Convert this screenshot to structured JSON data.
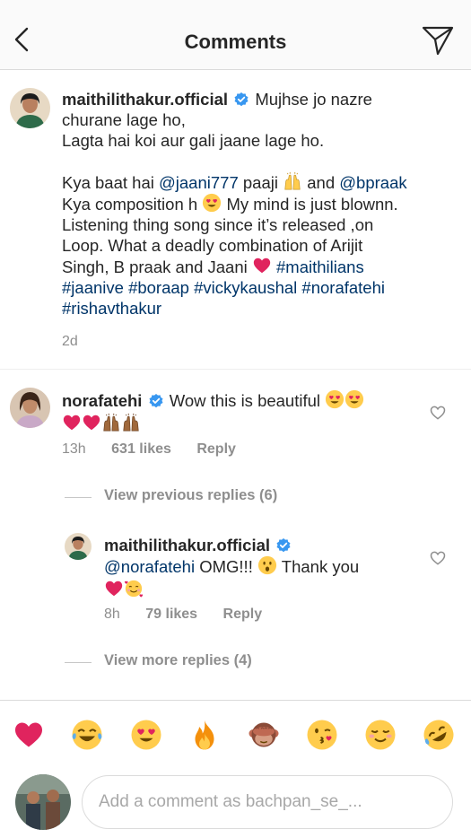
{
  "header": {
    "title": "Comments"
  },
  "post": {
    "username": "maithilithakur.official",
    "line1": "Mujhse jo nazre",
    "line2": "churane lage ho,",
    "line3": "Lagta hai koi aur gali jaane lage ho.",
    "p2_a": "Kya baat hai ",
    "mention1": "@jaani777",
    "p2_b": " paaji ",
    "p2_c": " and ",
    "mention2": "@bpraak",
    "p2_d": "Kya composition h ",
    "p2_e": " My mind is just blownn.",
    "p2_f": "Listening thing song since it’s released ,on",
    "p2_g": "Loop. What a deadly combination of Arijit",
    "p2_h": "Singh, B praak and Jaani ",
    "tag1": "#maithilians",
    "tag2": "#jaanive",
    "tag3": "#boraap",
    "tag4": "#vickykaushal",
    "tag5": "#norafatehi",
    "tag6": "#rishavthakur",
    "time": "2d"
  },
  "comment1": {
    "username": "norafatehi",
    "text": "Wow this is beautiful",
    "time": "13h",
    "likes": "631 likes",
    "reply": "Reply",
    "view_previous": "View previous replies (6)"
  },
  "reply1": {
    "username": "maithilithakur.official",
    "mention": "@norafatehi",
    "text_a": " OMG!!! ",
    "text_b": " Thank you",
    "time": "8h",
    "likes": "79 likes",
    "reply": "Reply",
    "view_more": "View more replies (4)"
  },
  "emojis": [
    "heart",
    "joy",
    "heart-eyes",
    "fire",
    "see-no-evil",
    "kiss",
    "blush",
    "rofl"
  ],
  "input": {
    "placeholder": "Add a comment as bachpan_se_..."
  },
  "colors": {
    "verified": "#3897f0",
    "link": "#003569",
    "heart": "#e0245e",
    "meta": "#8e8e8e"
  }
}
